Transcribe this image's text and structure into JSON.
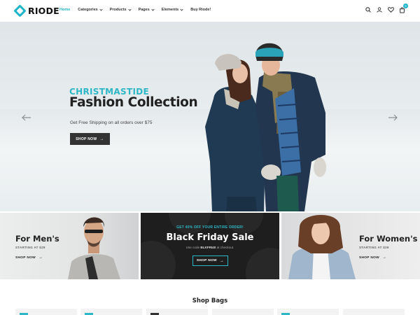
{
  "header": {
    "logo": "RIODE",
    "nav": [
      {
        "label": "Home",
        "dropdown": false,
        "active": true
      },
      {
        "label": "Categories",
        "dropdown": true,
        "active": false
      },
      {
        "label": "Products",
        "dropdown": true,
        "active": false
      },
      {
        "label": "Pages",
        "dropdown": true,
        "active": false
      },
      {
        "label": "Elements",
        "dropdown": true,
        "active": false
      },
      {
        "label": "Buy Riode!",
        "dropdown": false,
        "active": false
      }
    ],
    "icons": [
      "search-icon",
      "user-icon",
      "heart-icon",
      "cart-icon"
    ],
    "cart_count": "0"
  },
  "hero": {
    "subtitle": "CHRISTMASTIDE",
    "title": "Fashion Collection",
    "text": "Get Free Shipping on all orders over $75",
    "button": "SHOP NOW"
  },
  "banners": {
    "men": {
      "title": "For Men's",
      "subtitle": "STARTING AT $29",
      "link": "SHOP NOW"
    },
    "black_friday": {
      "promo": "GET 40% OFF YOUR ENTIRE ORDER!",
      "title": "Black Friday Sale",
      "code_prefix": "Use code",
      "code": "BLKFRI40",
      "code_suffix": "at checkout.",
      "button": "SHOP NOW"
    },
    "women": {
      "title": "For Women's",
      "subtitle": "STARTING AT $29",
      "link": "SHOP NOW"
    }
  },
  "section": {
    "title": "Shop Bags"
  },
  "colors": {
    "accent": "#2eb7c6",
    "dark": "#222222",
    "banner_dark": "#1e1e1e"
  }
}
